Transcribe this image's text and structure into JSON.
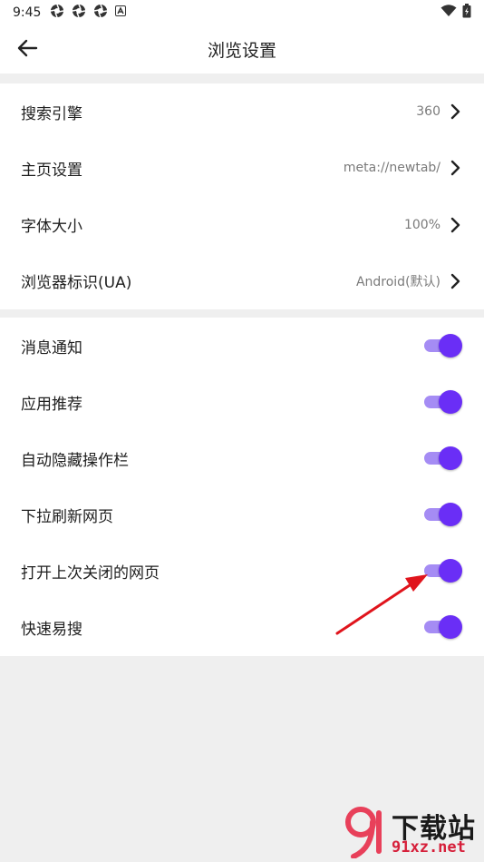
{
  "status_bar": {
    "time": "9:45",
    "notification_icons": [
      "aperture-icon",
      "aperture-icon",
      "aperture-icon",
      "a-letter-icon"
    ],
    "right_icons": [
      "wifi-icon",
      "battery-icon"
    ]
  },
  "app_bar": {
    "title": "浏览设置",
    "back_icon": "arrow-left-icon"
  },
  "settings_group_1": [
    {
      "label": "搜索引擎",
      "value": "360"
    },
    {
      "label": "主页设置",
      "value": "meta://newtab/"
    },
    {
      "label": "字体大小",
      "value": "100%"
    },
    {
      "label": "浏览器标识(UA)",
      "value": "Android(默认)"
    }
  ],
  "settings_group_2": [
    {
      "label": "消息通知",
      "on": true
    },
    {
      "label": "应用推荐",
      "on": true
    },
    {
      "label": "自动隐藏操作栏",
      "on": true
    },
    {
      "label": "下拉刷新网页",
      "on": true
    },
    {
      "label": "打开上次关闭的网页",
      "on": true
    },
    {
      "label": "快速易搜",
      "on": true
    }
  ],
  "watermark": {
    "brand": "下载站",
    "domain": "91xz.net"
  },
  "colors": {
    "accent": "#6a2ef6",
    "track": "#a58cf4",
    "annotation_arrow": "#e0141c"
  }
}
